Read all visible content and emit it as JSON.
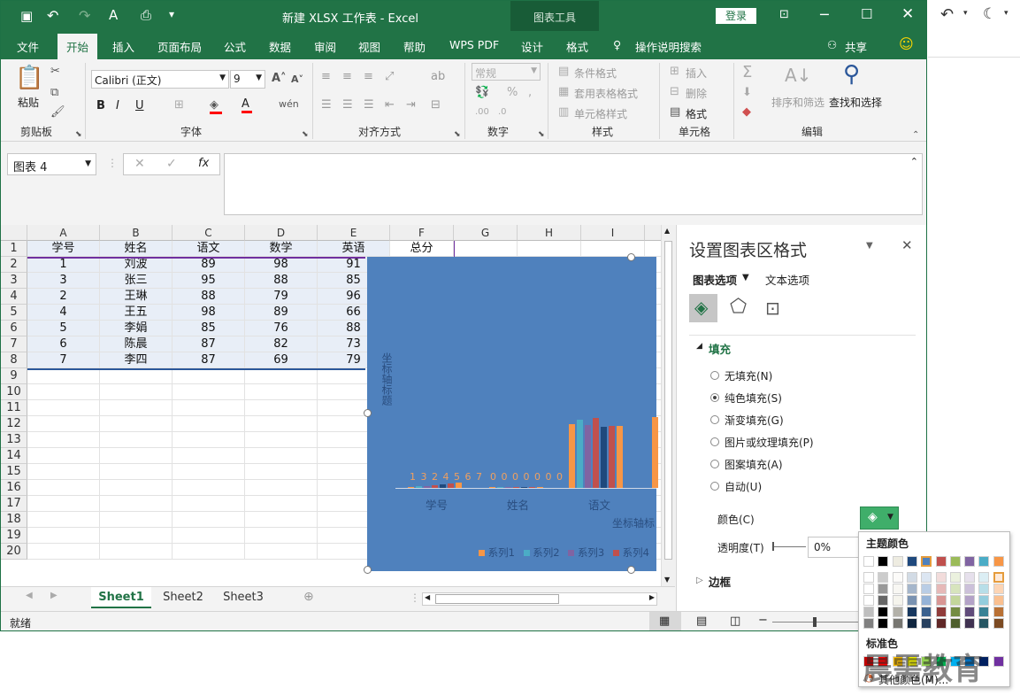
{
  "title_bar": {
    "title": "新建 XLSX 工作表  -  Excel",
    "context_group": "图表工具",
    "login_label": "登录"
  },
  "tabs": [
    "文件",
    "开始",
    "插入",
    "页面布局",
    "公式",
    "数据",
    "审阅",
    "视图",
    "帮助",
    "WPS PDF",
    "设计",
    "格式"
  ],
  "tell_me": "操作说明搜索",
  "share_label": "共享",
  "ribbon": {
    "paste_label": "粘贴",
    "clipboard_label": "剪贴板",
    "font_name": "Calibri (正文)",
    "font_size": "9",
    "font_label": "字体",
    "align_label": "对齐方式",
    "number_format": "常规",
    "number_label": "数字",
    "conditional_format": "条件格式",
    "table_format": "套用表格格式",
    "cell_style": "单元格样式",
    "styles_label": "样式",
    "insert_label": "插入",
    "delete_label": "删除",
    "format_label": "格式",
    "cells_label": "单元格",
    "sort_filter": "排序和筛选",
    "find_select": "查找和选择",
    "edit_label": "编辑"
  },
  "formula_bar": {
    "name_box": "图表 4",
    "fx": "fx"
  },
  "sheet": {
    "columns": [
      "A",
      "B",
      "C",
      "D",
      "E",
      "F",
      "G",
      "H",
      "I"
    ],
    "rows": [
      "1",
      "2",
      "3",
      "4",
      "5",
      "6",
      "7",
      "8",
      "9",
      "10",
      "11",
      "12",
      "13",
      "14",
      "15",
      "16",
      "17",
      "18",
      "19",
      "20"
    ],
    "headers": [
      "学号",
      "姓名",
      "语文",
      "数学",
      "英语",
      "总分"
    ],
    "data": [
      [
        "1",
        "刘波",
        "89",
        "98",
        "91"
      ],
      [
        "3",
        "张三",
        "95",
        "88",
        "85"
      ],
      [
        "2",
        "王琳",
        "88",
        "79",
        "96"
      ],
      [
        "4",
        "王五",
        "98",
        "89",
        "66"
      ],
      [
        "5",
        "李娟",
        "85",
        "76",
        "88"
      ],
      [
        "6",
        "陈晨",
        "87",
        "82",
        "73"
      ],
      [
        "7",
        "李四",
        "87",
        "69",
        "79"
      ]
    ]
  },
  "chart": {
    "y_axis_title": "坐标轴标题",
    "x_axis_title": "坐标轴标",
    "x_categories": [
      "学号",
      "姓名",
      "语文"
    ],
    "id_labels": "1 3 2 4 5 6 7",
    "zero_labels": "0 0 0 0 0 0 0",
    "legend": [
      "系列1",
      "系列2",
      "系列3",
      "系列4"
    ],
    "colors": {
      "series1": "#f79646",
      "series2": "#4bacc6",
      "series3": "#8064a2",
      "series4": "#c0504d",
      "series5": "#1f497d",
      "series6": "#c0504d"
    }
  },
  "chart_data": {
    "type": "bar",
    "categories": [
      "学号",
      "姓名",
      "语文"
    ],
    "series": [
      {
        "name": "系列1",
        "values": [
          1,
          0,
          89
        ]
      },
      {
        "name": "系列2",
        "values": [
          3,
          0,
          95
        ]
      },
      {
        "name": "系列3",
        "values": [
          2,
          0,
          88
        ]
      },
      {
        "name": "系列4",
        "values": [
          4,
          0,
          98
        ]
      },
      {
        "values": [
          5,
          0,
          85
        ]
      },
      {
        "values": [
          6,
          0,
          87
        ]
      },
      {
        "values": [
          7,
          0,
          87
        ]
      }
    ],
    "xlabel": "坐标轴标",
    "ylabel": "坐标轴标题",
    "ylim": [
      0,
      100
    ]
  },
  "sheet_tabs": [
    "Sheet1",
    "Sheet2",
    "Sheet3"
  ],
  "status": "就绪",
  "pane": {
    "title": "设置图表区格式",
    "tab_chart_options": "图表选项",
    "tab_text_options": "文本选项",
    "fill_section": "填充",
    "options": [
      "无填充(N)",
      "纯色填充(S)",
      "渐变填充(G)",
      "图片或纹理填充(P)",
      "图案填充(A)",
      "自动(U)"
    ],
    "selected_option": 1,
    "color_label": "颜色(C)",
    "transparency_label": "透明度(T)",
    "transparency_value": "0%",
    "border_section": "边框"
  },
  "palette": {
    "theme_label": "主题颜色",
    "standard_label": "标准色",
    "more_colors": "其他颜色(M)...",
    "theme_colors": [
      "#ffffff",
      "#000000",
      "#eeece1",
      "#1f497d",
      "#4f81bd",
      "#c0504d",
      "#9bbb59",
      "#8064a2",
      "#4bacc6",
      "#f79646"
    ],
    "standard_colors": [
      "#c00000",
      "#ff0000",
      "#ffc000",
      "#ffff00",
      "#92d050",
      "#00b050",
      "#00b0f0",
      "#0070c0",
      "#002060",
      "#7030a0"
    ]
  },
  "watermark": "晨需教育"
}
